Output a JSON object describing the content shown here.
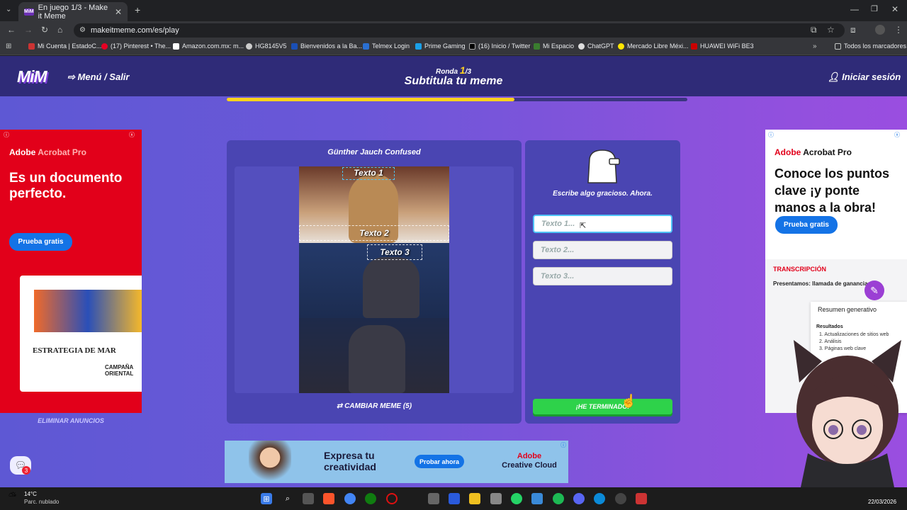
{
  "browser": {
    "tab_title": "En juego 1/3 - Make it Meme",
    "tab_favicon": "MiM",
    "url": "makeitmeme.com/es/play",
    "bookmarks": [
      "Mi Cuenta | EstadoC...",
      "(17) Pinterest • The...",
      "Amazon.com.mx: m...",
      "HG8145V5",
      "Bienvenidos a la Ba...",
      "Telmex Login",
      "Prime Gaming",
      "(16) Inicio / Twitter",
      "Mi Espacio",
      "ChatGPT",
      "Mercado Libre Méxi...",
      "HUAWEI WiFi BE3"
    ],
    "all_bookmarks": "Todos los marcadores"
  },
  "header": {
    "logo": "MiM",
    "menu": "Menú / Salir",
    "round_label": "Ronda",
    "round_current": "1",
    "round_total": "/3",
    "subtitle": "Subtitula tu meme",
    "login": "Iniciar sesión",
    "progress": 0.625
  },
  "meme": {
    "title": "Günther Jauch Confused",
    "text1": "Texto 1",
    "text2": "Texto 2",
    "text3": "Texto 3",
    "change_button": "CAMBIAR MEME (5)"
  },
  "inputs": {
    "prompt": "Escribe algo gracioso. Ahora.",
    "placeholder1": "Texto 1...",
    "placeholder2": "Texto 2...",
    "placeholder3": "Texto 3...",
    "done_button": "¡HE TERMINADO!"
  },
  "ad_left": {
    "brand": "Adobe",
    "product": "Acrobat Pro",
    "headline": "Es un documento perfecto.",
    "button": "Prueba gratis",
    "doc_heading": "ESTRATEGIA DE MAR",
    "doc_side": "CAMPAÑA ORIENTAL",
    "remove_ads": "ELIMINAR ANUNCIOS"
  },
  "ad_right": {
    "brand": "Adobe",
    "product": "Acrobat Pro",
    "headline": "Conoce los puntos clave ¡y ponte manos a la obra!",
    "button": "Prueba gratis",
    "section": "TRANSCRIPCIÓN",
    "sub": "Presentamos: llamada de ganancias",
    "summary": "Resumen generativo",
    "results": "Resultados",
    "r1": "1. Actualizaciones de sitios web",
    "r2": "2. Análisis",
    "r3": "3. Páginas web clave"
  },
  "banner": {
    "headline": "Expresa tu creatividad",
    "button": "Probar ahora",
    "brand": "Adobe",
    "product": "Creative Cloud"
  },
  "chat_badge": "3",
  "taskbar": {
    "temp": "14°C",
    "weather": "Parc. nublado",
    "date": "22/03/2026"
  },
  "colors": {
    "accent": "#ffd21e",
    "done": "#2ed24a",
    "panel": "#4a45b2",
    "header": "#2f2b78"
  }
}
